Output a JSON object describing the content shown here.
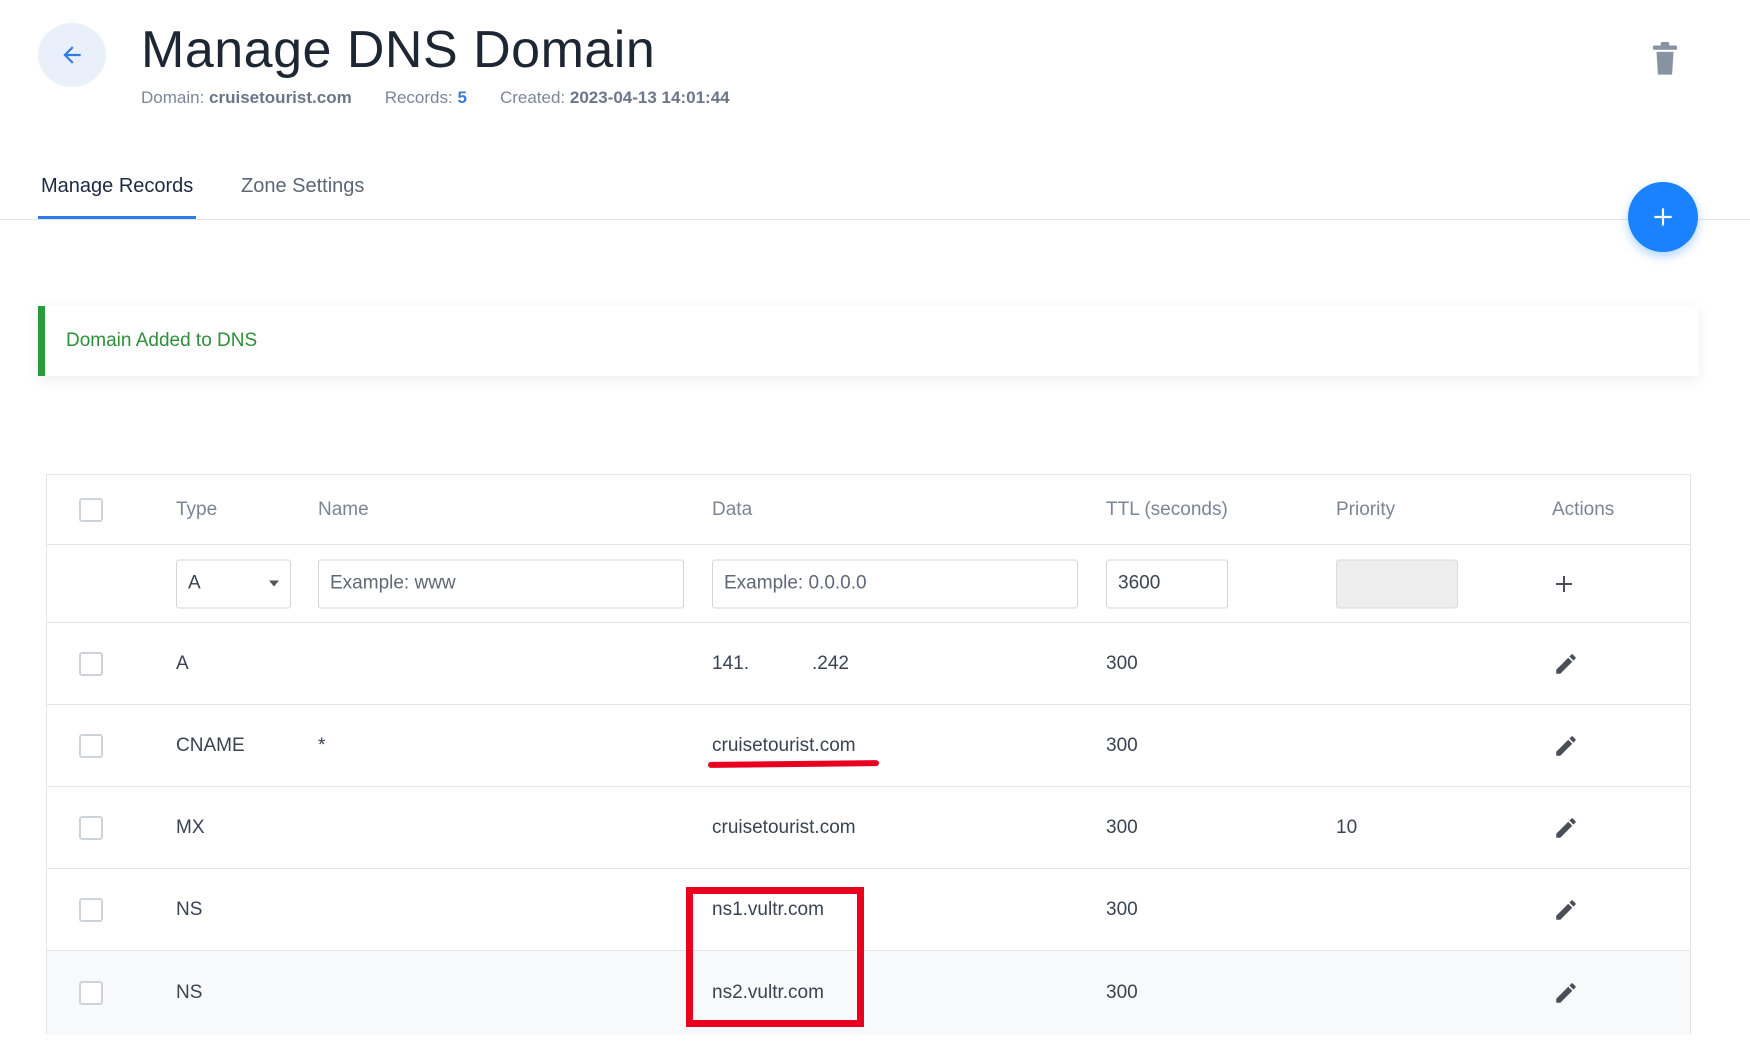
{
  "header": {
    "title": "Manage DNS Domain",
    "domain_label": "Domain:",
    "domain_value": "cruisetourist.com",
    "records_label": "Records:",
    "records_value": "5",
    "created_label": "Created:",
    "created_value": "2023-04-13 14:01:44"
  },
  "tabs": [
    {
      "label": "Manage Records",
      "active": true
    },
    {
      "label": "Zone Settings",
      "active": false
    }
  ],
  "alert": {
    "message": "Domain Added to DNS",
    "color": "#2a9a3b"
  },
  "table": {
    "columns": [
      "Type",
      "Name",
      "Data",
      "TTL (seconds)",
      "Priority",
      "Actions"
    ],
    "new_record": {
      "type_value": "A",
      "name_placeholder": "Example: www",
      "data_placeholder": "Example: 0.0.0.0",
      "ttl_value": "3600",
      "priority_value": ""
    },
    "records": [
      {
        "type": "A",
        "name": "",
        "data_a": "141.",
        "data_b": ".242",
        "ttl": "300",
        "priority": ""
      },
      {
        "type": "CNAME",
        "name": "*",
        "data": "cruisetourist.com",
        "ttl": "300",
        "priority": ""
      },
      {
        "type": "MX",
        "name": "",
        "data": "cruisetourist.com",
        "ttl": "300",
        "priority": "10"
      },
      {
        "type": "NS",
        "name": "",
        "data": "ns1.vultr.com",
        "ttl": "300",
        "priority": ""
      },
      {
        "type": "NS",
        "name": "",
        "data": "ns2.vultr.com",
        "ttl": "300",
        "priority": ""
      }
    ]
  },
  "icons": {
    "back": "arrow-left-icon",
    "delete": "trash-icon",
    "add_fab": "plus-icon",
    "add_row": "plus-icon",
    "edit": "pencil-icon"
  },
  "colors": {
    "accent": "#1a82ff",
    "annotation": "#e8001e"
  }
}
